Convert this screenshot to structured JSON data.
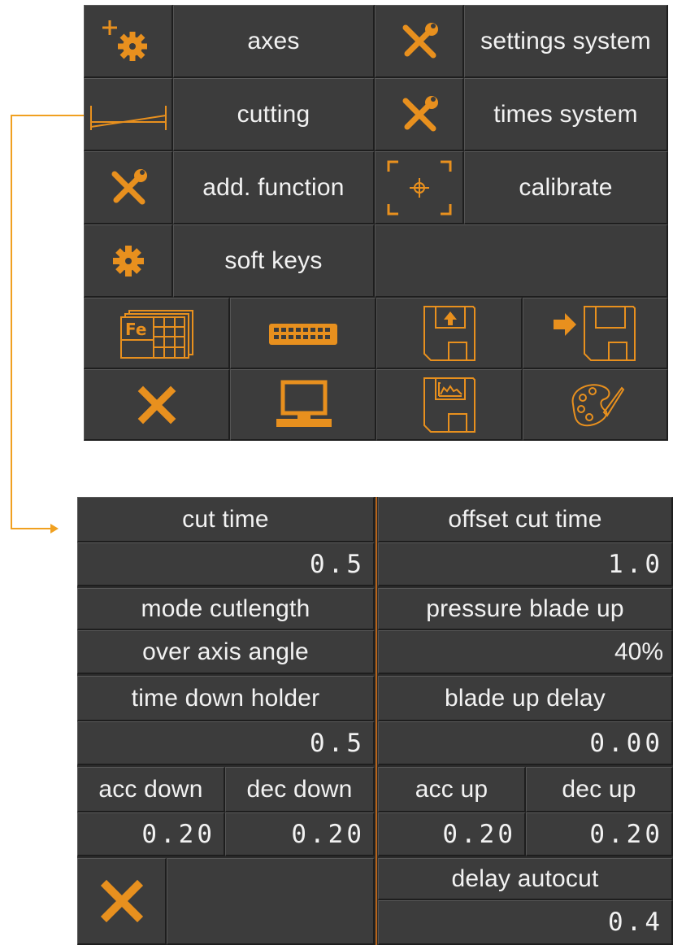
{
  "menu": {
    "axes": "axes",
    "settings_system": "settings system",
    "cutting": "cutting",
    "times_system": "times system",
    "add_function": "add. function",
    "calibrate": "calibrate",
    "soft_keys": "soft keys",
    "icons": [
      "material-table-icon",
      "keyboard-icon",
      "floppy-upload-icon",
      "floppy-import-icon",
      "close-icon",
      "monitor-icon",
      "floppy-image-icon",
      "palette-icon"
    ],
    "fe_label": "Fe"
  },
  "times": {
    "cut_time_label": "cut time",
    "cut_time_value": "0.5",
    "offset_cut_time_label": "offset cut time",
    "offset_cut_time_value": "1.0",
    "mode_cutlength_label": "mode cutlength",
    "mode_cutlength_value": "over axis angle",
    "pressure_blade_up_label": "pressure blade up",
    "pressure_blade_up_value": "40%",
    "time_down_holder_label": "time down holder",
    "time_down_holder_value": "0.5",
    "blade_up_delay_label": "blade up delay",
    "blade_up_delay_value": "0.00",
    "acc_down_label": "acc down",
    "acc_down_value": "0.20",
    "dec_down_label": "dec down",
    "dec_down_value": "0.20",
    "acc_up_label": "acc up",
    "acc_up_value": "0.20",
    "dec_up_label": "dec up",
    "dec_up_value": "0.20",
    "delay_autocut_label": "delay autocut",
    "delay_autocut_value": "0.4"
  },
  "colors": {
    "accent": "#e8901e",
    "panel": "#3c3c3c",
    "text": "#f2f2f2",
    "connector": "#f0a020"
  }
}
